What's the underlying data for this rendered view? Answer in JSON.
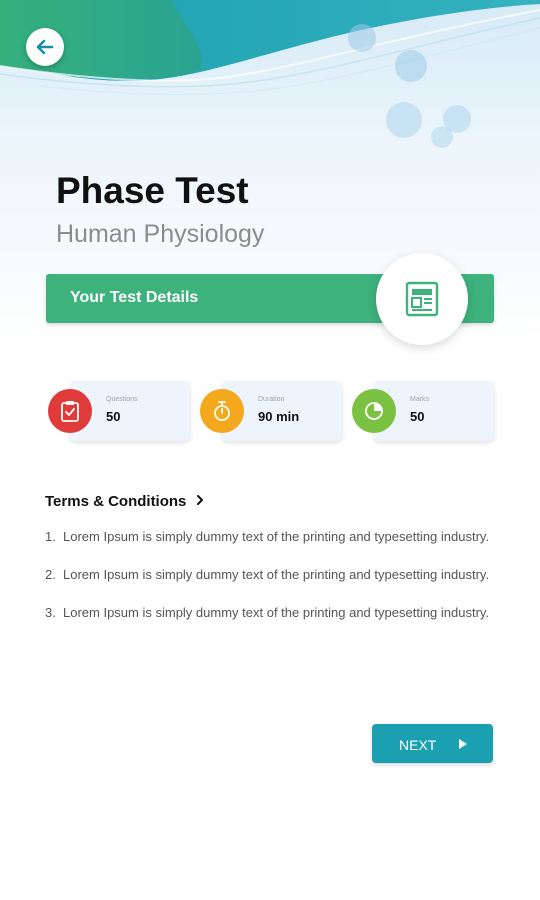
{
  "header": {
    "title": "Phase Test",
    "subtitle": "Human Physiology"
  },
  "details": {
    "label": "Your Test Details",
    "icon": "document-icon"
  },
  "stats": [
    {
      "label": "Questions",
      "value": "50",
      "icon": "clipboard-check-icon",
      "color": "#e03a3a"
    },
    {
      "label": "Duration",
      "value": "90 min",
      "icon": "stopwatch-icon",
      "color": "#f3a81d"
    },
    {
      "label": "Marks",
      "value": "50",
      "icon": "pie-chart-icon",
      "color": "#7cc242"
    }
  ],
  "terms": {
    "heading": "Terms & Conditions",
    "items": [
      {
        "num": "1.",
        "text": "Lorem Ipsum is simply dummy text of the printing and typesetting industry."
      },
      {
        "num": "2.",
        "text": "Lorem Ipsum is simply dummy text of the printing and typesetting industry."
      },
      {
        "num": "3.",
        "text": "Lorem Ipsum is simply dummy text of the printing and typesetting industry."
      }
    ]
  },
  "actions": {
    "next_label": "NEXT"
  },
  "colors": {
    "primary_green": "#3db27c",
    "accent_teal": "#1aa0b0"
  }
}
